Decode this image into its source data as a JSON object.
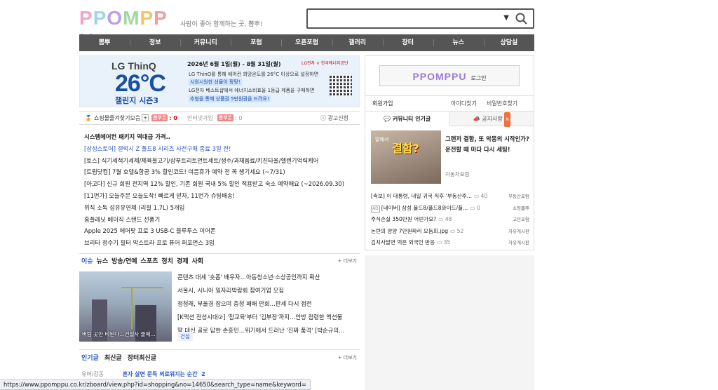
{
  "header": {
    "logo": "PPOMPPU",
    "tagline": "사람이 좋아 함께하는 곳, 뽐뿌!",
    "search_placeholder": ""
  },
  "nav": [
    "뽐뿌",
    "정보",
    "커뮤니티",
    "포럼",
    "오픈포럼",
    "갤러리",
    "장터",
    "뉴스",
    "상담실"
  ],
  "banner": {
    "brand": "LG ThinQ",
    "big": "26°C",
    "sub": "챌린지 시즌3",
    "date": "2026년 6월 1일(월) - 8월 31일(월)",
    "line1": "LG ThinQ를 통해 에어컨 희망온도를 26°C 이상으로 설정하면",
    "line2": "시원시원한 선물이 팡팡!",
    "line3": "LG전자 베스트샵에서 에너지소비효율 1등급 제품을 구매하면",
    "line4": "추첨을 통해 상품권 5만원권을 드려요!",
    "logos": "LG전자 × 한국에너지공단"
  },
  "shopbar": {
    "label": "쇼핑몰즐겨찾기모음",
    "plus": "+",
    "badge1": "뽐뿌몬",
    "count1": ": 0",
    "mid": "인터넷가입",
    "badge2": "뽐뿌몬",
    "count2": ": 0",
    "ad": "광고신청"
  },
  "list1": [
    "시스템에어컨 패키지 역대급 가격..",
    "[삼성스토어] 갤럭시 Z 폴드8 시리즈 사전구매 종료 3일 전!",
    "[토스] 식기세척기세제/제육불고기/샴푸트리트먼트세트/생수/과채음료/키친타올/헬렌기억력케어",
    "[트립닷컴] 7월 호텔&항공 3% 할인코드! 여름휴가 예약 전 꼭 챙기세요 (~7/31)",
    "[아고다] 신규 회원 전지역 12% 할인, 기존 회원 국내 5% 할인 적용받고 숙소 예약해요 (~2026.09.30)",
    "[11번가] 오늘주문 오늘도착! 빠르게 받자, 11번가 슈팅배송!",
    "위칙 소독 섬유유연제 (리필 1.7L) 5개입",
    "홈플래닛 베이직 스탠드 선풍기",
    "Apple 2025 에어팟 프로 3 USB-C 블루투스 이어폰",
    "브리타 정수기 필터 막스트라 프로 퓨어 퍼포먼스 3입"
  ],
  "news_tabs": [
    "이슈",
    "뉴스",
    "방송/연예",
    "스포츠",
    "정치",
    "경제",
    "사회"
  ],
  "more": "+ 더보기",
  "news": {
    "photo_caption": "버팀 곳만 비된다…건설사 줄폐...",
    "items": [
      "콘텐츠 대세 '숏폼' 배우자…아동청소년·소상공인까지 확산",
      "서울시, 시니어 일자리박람회 참여기업 모집",
      "정청래, 부울경 잡으며 충청 패배 만회…판세 다시 접전",
      "[K액션 전성시대②] '참교육'부터 '김부장'까지…안방 점령한 액션물",
      "말 대신 골로 답한 손흥민…위기에서 드러난 '진짜 품격' [박순규의..."
    ],
    "tag": "건설"
  },
  "hot_tabs": [
    "인기글",
    "최신글",
    "장터최신글"
  ],
  "hot_item": {
    "cat": "유머/감동",
    "title": "혼자 살면 문득 외로워지는 순간",
    "count": "2"
  },
  "right": {
    "login_logo": "PPOMPPU",
    "login_text": "로그인",
    "join": "회원가입",
    "find_id": "아이디찾기",
    "find_pw": "비밀번호찾기",
    "tab_community": "커뮤니티 인기글",
    "tab_notice": "공지사항",
    "new_badge": "N",
    "feat_img_text": "결함?",
    "feat_img_small": "말해서",
    "feat_title": "그랜저 결함, 또 악몽의 시작인가? 운전할 때 마다 다시 세팅!",
    "feat_cat": "자동차포럼",
    "items": [
      {
        "ad": "",
        "title": "[속보] 이 대통령, 내일 귀국 직후 '부동산주...",
        "cmt": "40",
        "src": "부동산포럼"
      },
      {
        "ad": "AD",
        "title": "[네이버] 삼성 폴드8/폴드8와이드/플...",
        "cmt": "0",
        "src": "쇼핑뽐뿌"
      },
      {
        "ad": "",
        "title": "주식손실 350만원 어떤가요?",
        "cmt": "48",
        "src": "고민포럼"
      },
      {
        "ad": "",
        "title": "논란의 양양 7만원짜리 모듬회.jpg",
        "cmt": "52",
        "src": "자유게시판"
      },
      {
        "ad": "",
        "title": "김치사발면 먹은 외국인 반응",
        "cmt": "35",
        "src": "자유게시판"
      }
    ]
  },
  "status_url": "https://www.ppomppu.co.kr/zboard/view.php?id=shopping&no=14650&search_type=name&keyword=",
  "colors": {
    "nav_bg": "#555555",
    "link_blue": "#2a56c6",
    "accent_red": "#cc0000"
  }
}
